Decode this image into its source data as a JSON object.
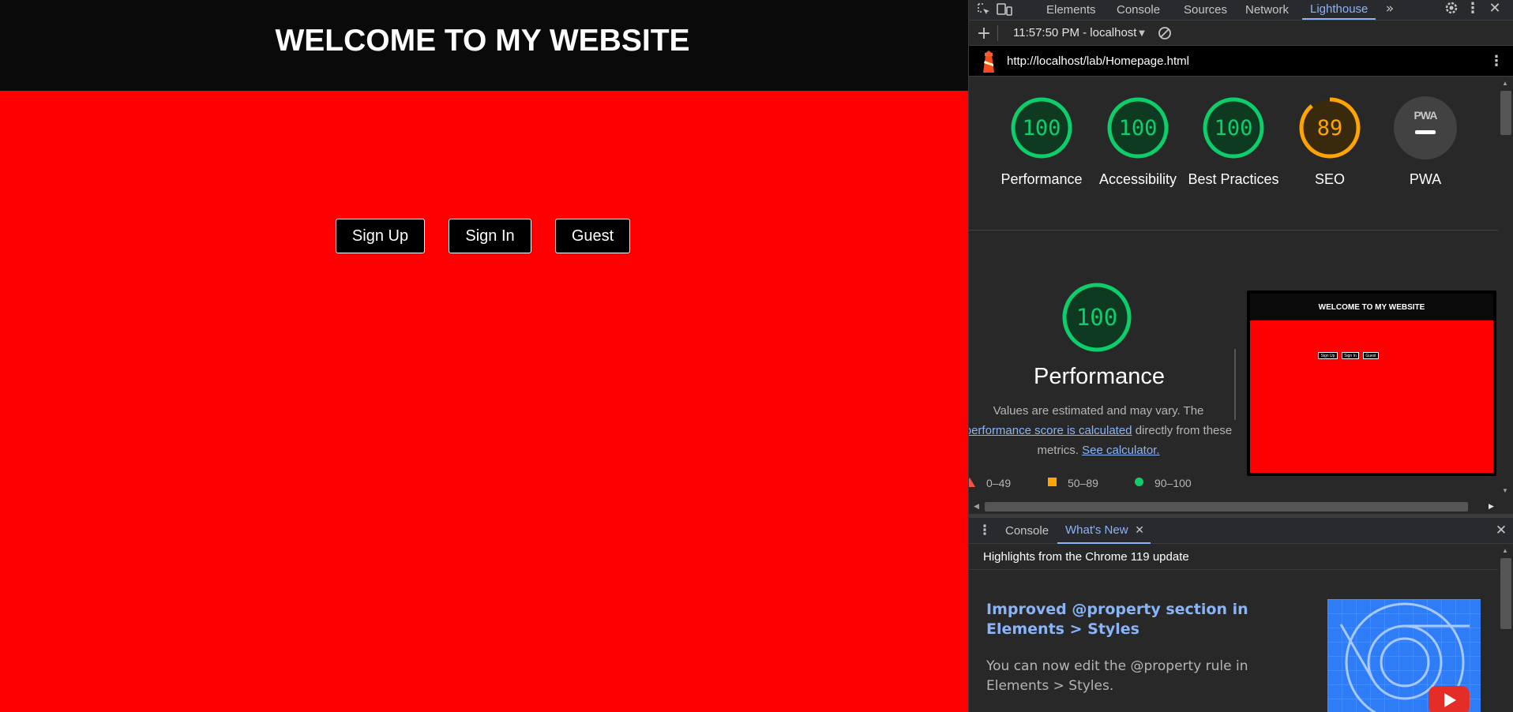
{
  "site": {
    "title": "WELCOME TO MY WEBSITE",
    "buttons": [
      "Sign Up",
      "Sign In",
      "Guest"
    ]
  },
  "devtools": {
    "tabs": [
      "Elements",
      "Console",
      "Sources",
      "Network",
      "Lighthouse"
    ],
    "active_tab": "Lighthouse",
    "overflow_icon": "chevrons-right-icon",
    "report_selector": "11:57:50 PM - localhost",
    "url": "http://localhost/lab/Homepage.html",
    "scores": [
      {
        "label": "Performance",
        "value": "100",
        "status": "pass"
      },
      {
        "label": "Accessibility",
        "value": "100",
        "status": "pass"
      },
      {
        "label": "Best Practices",
        "value": "100",
        "status": "pass"
      },
      {
        "label": "SEO",
        "value": "89",
        "status": "average"
      },
      {
        "label": "PWA",
        "value": "PWA",
        "status": "na"
      }
    ],
    "performance": {
      "score": "100",
      "title": "Performance",
      "desc_1": "Values are estimated and may vary. The",
      "desc_link": "performance score is calculated",
      "desc_2": "directly from these",
      "desc_3": "metrics.",
      "calc_link": "See calculator."
    },
    "legend": [
      "0–49",
      "50–89",
      "90–100"
    ],
    "thumbnail": {
      "title": "WELCOME TO MY WEBSITE",
      "buttons": [
        "Sign Up",
        "Sign In",
        "Guest"
      ]
    },
    "drawer": {
      "tabs": [
        "Console",
        "What's New"
      ],
      "active_tab": "What's New",
      "highlight": "Highlights from the Chrome 119 update",
      "feature_title": "Improved @property section in Elements > Styles",
      "feature_desc": "You can now edit the @property rule in Elements > Styles."
    }
  },
  "colors": {
    "page_bg": "#ff0000",
    "header_bg": "#0a0a0a",
    "pass": "#0cce6b",
    "average": "#ffa400",
    "fail": "#ff4e42",
    "link": "#8ab4f8"
  }
}
